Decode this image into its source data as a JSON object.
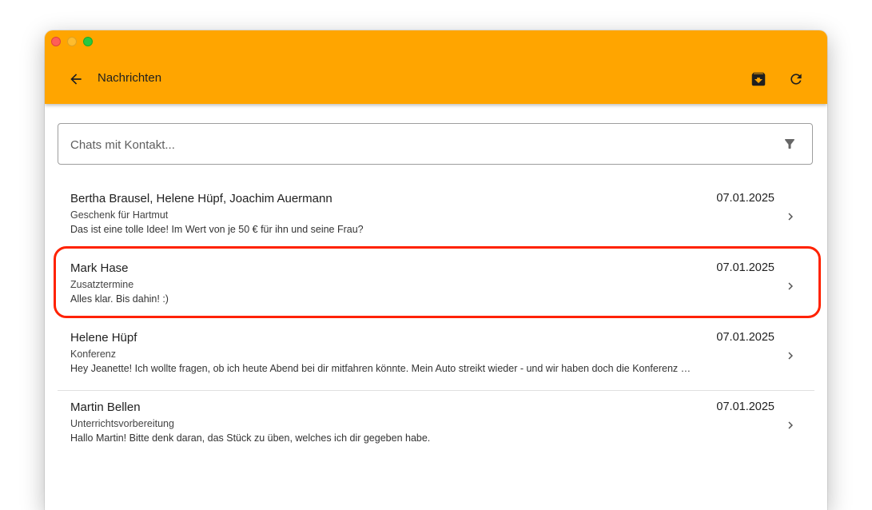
{
  "app": {
    "title": "Nachrichten"
  },
  "icons": {
    "back": "arrow-left-icon",
    "archive": "archive-icon",
    "refresh": "refresh-icon",
    "filter": "filter-icon",
    "chevron": "chevron-right-icon"
  },
  "colors": {
    "header": "#ffa500",
    "highlight": "#ff2200"
  },
  "search": {
    "placeholder": "Chats mit Kontakt..."
  },
  "chats": [
    {
      "name": "Bertha Brausel, Helene Hüpf, Joachim Auermann",
      "subject": "Geschenk für Hartmut",
      "preview": "Das ist eine tolle Idee! Im Wert von je 50 € für ihn und seine Frau?",
      "date": "07.01.2025"
    },
    {
      "name": "Mark Hase",
      "subject": "Zusatztermine",
      "preview": "Alles klar. Bis dahin! :)",
      "date": "07.01.2025"
    },
    {
      "name": "Helene Hüpf",
      "subject": "Konferenz",
      "preview": "Hey Jeanette! Ich wollte fragen, ob ich heute Abend bei dir mitfahren könnte. Mein Auto streikt wieder - und wir haben doch die Konferenz morgen früh.",
      "date": "07.01.2025"
    },
    {
      "name": "Martin Bellen",
      "subject": "Unterrichtsvorbereitung",
      "preview": "Hallo Martin! Bitte denk daran, das Stück zu üben, welches ich dir gegeben habe.",
      "date": "07.01.2025"
    }
  ]
}
